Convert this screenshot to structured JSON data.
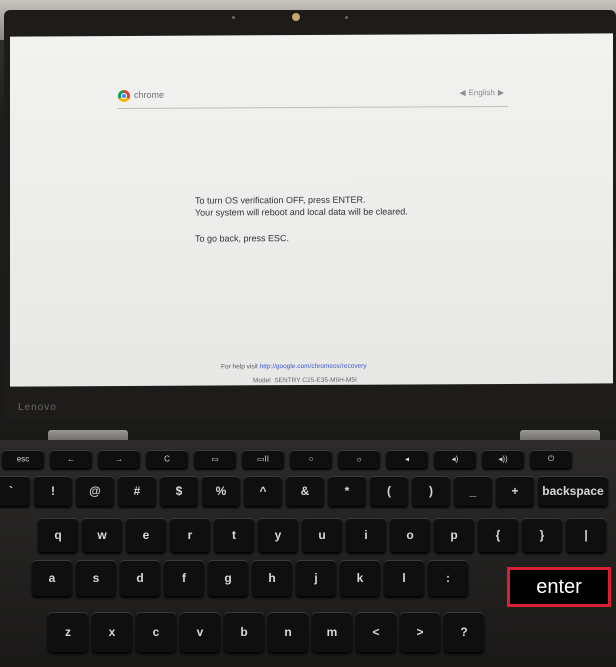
{
  "screen": {
    "brand": "chrome",
    "language": "English",
    "line1": "To turn OS verification OFF, press ENTER.",
    "line2": "Your system will reboot and local data will be cleared.",
    "line3": "To go back, press ESC.",
    "help_prefix": "For help visit",
    "help_link": "http://google.com/chromeos/recovery",
    "model_label": "Model",
    "model_value": "SENTRY C25-E35-M6H-M5I"
  },
  "laptop": {
    "brand": "Lenovo"
  },
  "callout": {
    "label": "enter",
    "border_color": "#d92030"
  },
  "keyboard": {
    "function_row": [
      "esc",
      "←",
      "→",
      "C",
      "▭",
      "▭II",
      "○",
      "☼",
      "◂",
      "◂)",
      "◂))",
      "⏻"
    ],
    "number_row": [
      "`",
      "!",
      "@",
      "#",
      "$",
      "%",
      "^",
      "&",
      "*",
      "(",
      ")",
      "_",
      "+",
      "backspace"
    ],
    "qwerty_row": [
      "q",
      "w",
      "e",
      "r",
      "t",
      "y",
      "u",
      "i",
      "o",
      "p",
      "{",
      "}",
      "|"
    ],
    "home_row": [
      "a",
      "s",
      "d",
      "f",
      "g",
      "h",
      "j",
      "k",
      "l",
      ":"
    ],
    "bottom_row": [
      "z",
      "x",
      "c",
      "v",
      "b",
      "n",
      "m",
      "<",
      ">",
      "?"
    ]
  }
}
